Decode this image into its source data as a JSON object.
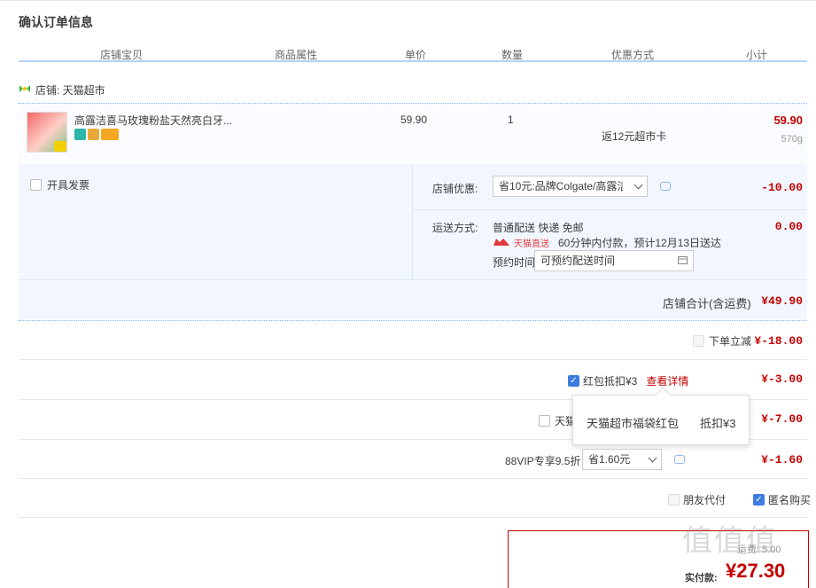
{
  "page_title": "确认订单信息",
  "columns": [
    "店铺宝贝",
    "商品属性",
    "单价",
    "数量",
    "优惠方式",
    "小计"
  ],
  "shop": {
    "label": "店铺: 天猫超市"
  },
  "item": {
    "name": "高露洁喜马玫瑰粉盐天然亮白牙...",
    "price": "59.90",
    "quantity": "1",
    "promo": "返12元超市卡",
    "subtotal": "59.90",
    "weight": "570g"
  },
  "invoice": {
    "label": "开具发票"
  },
  "shop_discount": {
    "label": "店铺优惠:",
    "selected": "省10元:品牌Colgate/高露洁",
    "amount": "-10.00"
  },
  "shipping": {
    "label": "运送方式:",
    "method": "普通配送 快递 免邮",
    "tmall_direct": "天猫直送",
    "eta": "60分钟内付款，预计12月13日送达",
    "schedule_label": "预约时间",
    "schedule_placeholder": "可预约配送时间",
    "amount": "0.00"
  },
  "shop_total": {
    "label": "店铺合计(含运费)",
    "amount": "¥49.90"
  },
  "order_discount": {
    "label": "下单立减",
    "amount": "¥-18.00"
  },
  "red_packet": {
    "label": "红包抵扣¥3",
    "link": "查看详情",
    "amount": "¥-3.00"
  },
  "tmall_row": {
    "label": "天猫",
    "amount": "¥-7.00"
  },
  "vip": {
    "label": "88VIP专享9.5折",
    "selected": "省1.60元",
    "amount": "¥-1.60"
  },
  "options": {
    "friend_pay": "朋友代付",
    "anonymous": "匿名购买"
  },
  "popup": {
    "name": "天猫超市福袋红包",
    "value": "抵扣¥3"
  },
  "total": {
    "prefix": "实付款:",
    "amount": "¥27.30",
    "top_text": "运费: 5.00"
  },
  "watermark": "值值值",
  "colors": {
    "accent_red": "#c40000",
    "blue_line": "#b2d1ff",
    "panel_bg": "#f2f7ff",
    "link_red": "#c40000"
  }
}
